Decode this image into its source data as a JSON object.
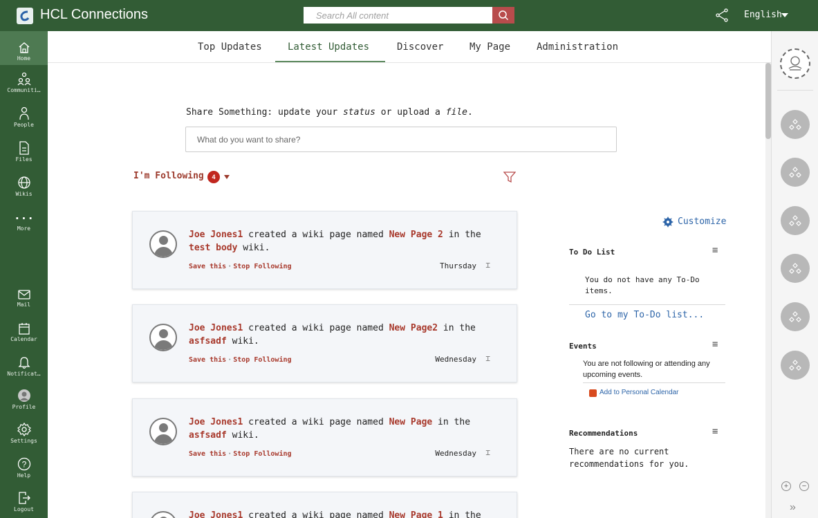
{
  "app": {
    "title": "HCL Connections"
  },
  "search": {
    "placeholder": "Search All content"
  },
  "header": {
    "language": "English"
  },
  "leftnav": {
    "items": [
      {
        "label": "Home",
        "icon": "home-icon"
      },
      {
        "label": "Communiti…",
        "icon": "communities-icon"
      },
      {
        "label": "People",
        "icon": "people-icon"
      },
      {
        "label": "Files",
        "icon": "files-icon"
      },
      {
        "label": "Wikis",
        "icon": "wikis-icon"
      },
      {
        "label": "More",
        "icon": "more-icon"
      },
      {
        "label": "Mail",
        "icon": "mail-icon"
      },
      {
        "label": "Calendar",
        "icon": "calendar-icon"
      },
      {
        "label": "Notificat…",
        "icon": "bell-icon"
      },
      {
        "label": "Profile",
        "icon": "profile-icon"
      },
      {
        "label": "Settings",
        "icon": "gear-icon"
      },
      {
        "label": "Help",
        "icon": "help-icon"
      },
      {
        "label": "Logout",
        "icon": "logout-icon"
      }
    ]
  },
  "tabs": [
    "Top Updates",
    "Latest Updates",
    "Discover",
    "My Page",
    "Administration"
  ],
  "active_tab": "Latest Updates",
  "share": {
    "label_pre": "Share Something: update your ",
    "label_status": "status",
    "label_mid": " or upload a ",
    "label_file": "file",
    "label_end": ".",
    "placeholder": "What do you want to share?"
  },
  "following": {
    "label": "I'm Following",
    "count": "4"
  },
  "stream": {
    "save": "Save this",
    "stop": "Stop Following",
    "dot": "·",
    "created_text": " created a wiki page named ",
    "in_the": " in the",
    "wiki_suffix": " wiki.",
    "items": [
      {
        "user": "Joe Jones1",
        "page": "New Page 2",
        "wiki": "test body",
        "date": "Thursday"
      },
      {
        "user": "Joe Jones1",
        "page": "New Page2",
        "wiki": "asfsadf",
        "date": "Wednesday"
      },
      {
        "user": "Joe Jones1",
        "page": "New Page",
        "wiki": "asfsadf",
        "date": "Wednesday"
      },
      {
        "user": "Joe Jones1",
        "page": "New Page 1",
        "wiki": "",
        "date": ""
      }
    ]
  },
  "sidebar": {
    "customize": "Customize",
    "todo": {
      "title": "To Do List",
      "text": "You do not have any To-Do items.",
      "link": "Go to my To-Do list..."
    },
    "events": {
      "title": "Events",
      "text": "You are not following or attending any upcoming events.",
      "link": "Add to Personal Calendar"
    },
    "recommendations": {
      "title": "Recommendations",
      "text": "There are no current recommendations for you."
    }
  },
  "colors": {
    "brand_green": "#325c35",
    "link_red": "#a8392c",
    "link_blue": "#2c64a8",
    "badge_red": "#c1271f"
  }
}
